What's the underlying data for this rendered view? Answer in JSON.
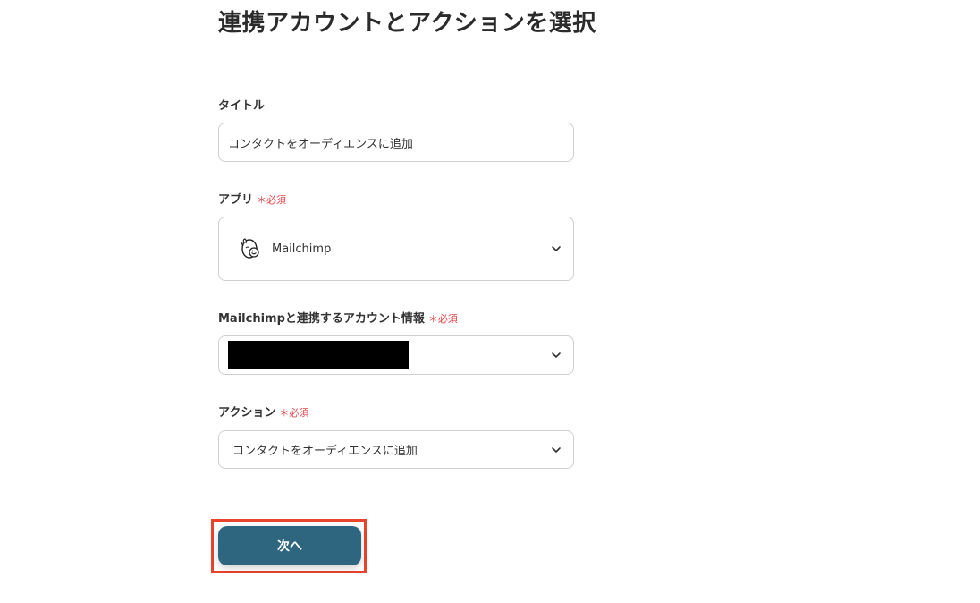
{
  "page": {
    "title": "連携アカウントとアクションを選択"
  },
  "form": {
    "title_field": {
      "label": "タイトル",
      "value": "コンタクトをオーディエンスに追加"
    },
    "app_field": {
      "label": "アプリ",
      "required_label": "＊必須",
      "value": "Mailchimp",
      "icon": "mailchimp-logo"
    },
    "account_field": {
      "label": "Mailchimpと連携するアカウント情報",
      "required_label": "＊必須",
      "value_redacted": true
    },
    "action_field": {
      "label": "アクション",
      "required_label": "＊必須",
      "value": "コンタクトをオーディエンスに追加"
    }
  },
  "buttons": {
    "next_label": "次へ"
  },
  "colors": {
    "primary_button": "#2e6680",
    "required_text": "#e0474c",
    "highlight_border": "#e8432b",
    "field_border": "#cfcfcf"
  }
}
